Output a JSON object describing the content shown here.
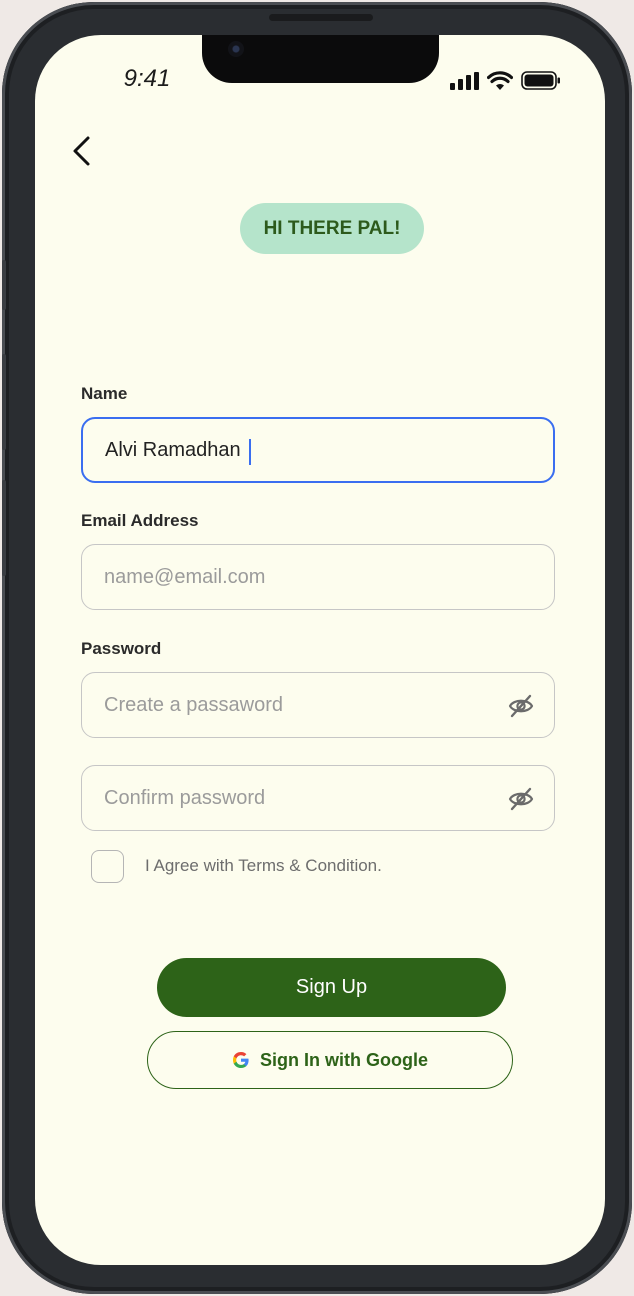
{
  "status_bar": {
    "time": "9:41"
  },
  "greeting": "HI THERE PAL!",
  "form": {
    "name": {
      "label": "Name",
      "value": "Alvi Ramadhan",
      "placeholder": ""
    },
    "email": {
      "label": "Email Address",
      "value": "",
      "placeholder": "name@email.com"
    },
    "password": {
      "label": "Password",
      "placeholder": "Create a passaword"
    },
    "confirm_password": {
      "placeholder": "Confirm password"
    },
    "terms": {
      "label": "I Agree with Terms & Condition.",
      "checked": false
    }
  },
  "buttons": {
    "sign_up": "Sign Up",
    "google": "Sign In with Google"
  },
  "colors": {
    "screen_bg": "#fdfdee",
    "accent_green": "#2d6318",
    "pill_bg": "#b5e4cb",
    "focus_blue": "#3a6ef0"
  },
  "icons": [
    "back-arrow-icon",
    "signal-icon",
    "wifi-icon",
    "battery-icon",
    "eye-off-icon",
    "google-icon"
  ]
}
